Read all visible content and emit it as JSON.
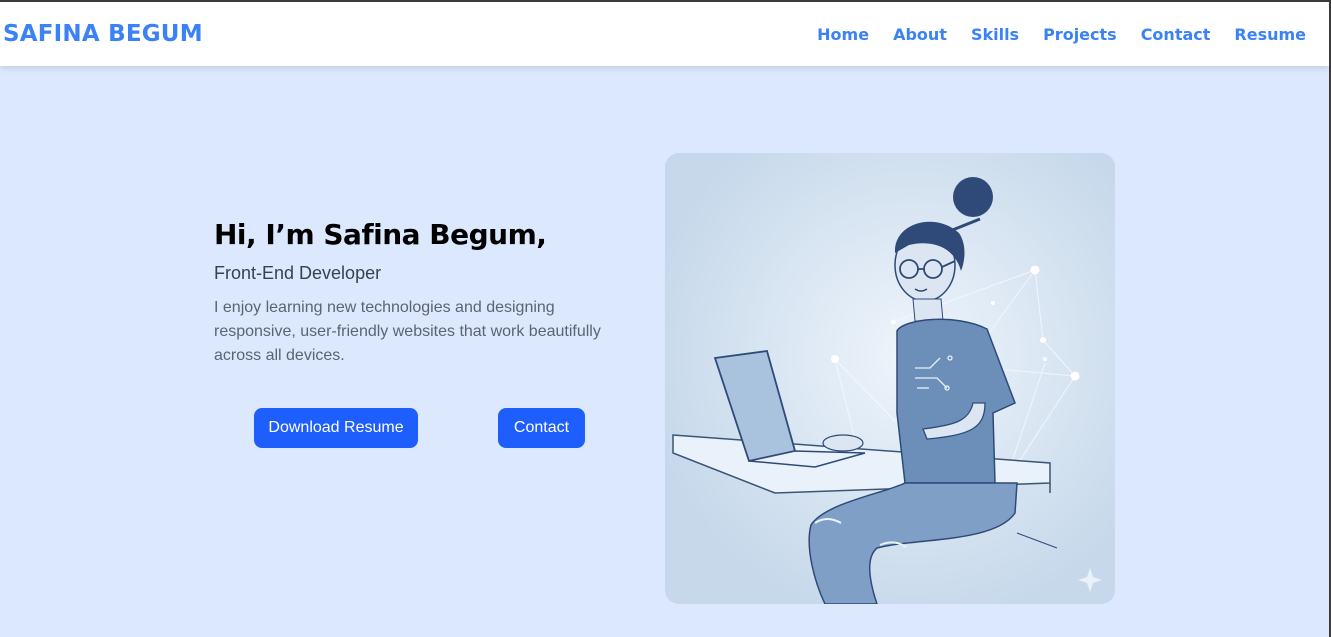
{
  "brand": "SAFINA BEGUM",
  "nav": {
    "home": "Home",
    "about": "About",
    "skills": "Skills",
    "projects": "Projects",
    "contact": "Contact",
    "resume": "Resume"
  },
  "hero": {
    "title": "Hi, I’m Safina Begum,",
    "role": "Front-End Developer",
    "description": "I enjoy learning new technologies and designing responsive, user-friendly websites that work beautifully across all devices.",
    "download_button": "Download Resume",
    "contact_button": "Contact"
  },
  "colors": {
    "accent": "#3b82f6",
    "button": "#1d5efd",
    "background": "#dbe8fd"
  }
}
